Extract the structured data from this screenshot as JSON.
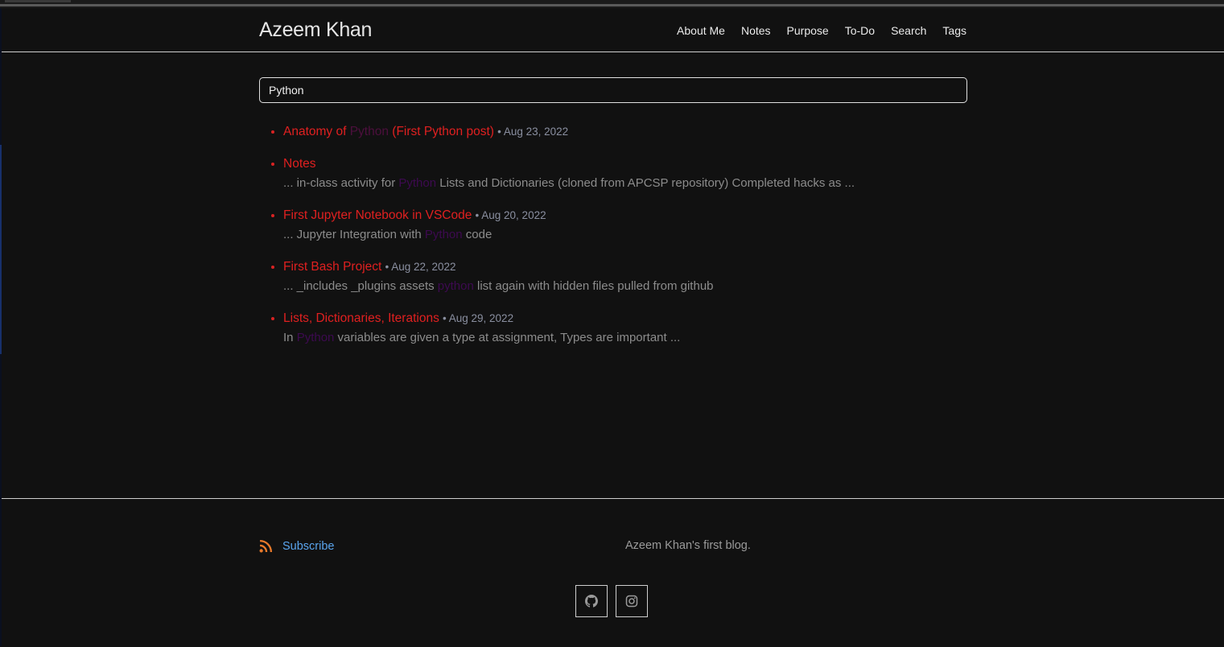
{
  "site": {
    "title": "Azeem Khan",
    "nav": [
      "About Me",
      "Notes",
      "Purpose",
      "To-Do",
      "Search",
      "Tags"
    ]
  },
  "search": {
    "value": "Python",
    "placeholder": ""
  },
  "results": [
    {
      "title_before": "Anatomy of ",
      "title_highlight": "Python",
      "title_after": " (First Python post)",
      "date": "Aug 23, 2022",
      "excerpt_before": "",
      "excerpt_highlight": "",
      "excerpt_after": ""
    },
    {
      "title_before": "Notes",
      "title_highlight": "",
      "title_after": "",
      "date": "",
      "excerpt_before": "... in-class activity for ",
      "excerpt_highlight": "Python",
      "excerpt_after": " Lists and Dictionaries (cloned from APCSP repository) Completed hacks as ..."
    },
    {
      "title_before": "First Jupyter Notebook in VSCode",
      "title_highlight": "",
      "title_after": "",
      "date": "Aug 20, 2022",
      "excerpt_before": "... Jupyter Integration with ",
      "excerpt_highlight": "Python",
      "excerpt_after": " code"
    },
    {
      "title_before": "First Bash Project",
      "title_highlight": "",
      "title_after": "",
      "date": "Aug 22, 2022",
      "excerpt_before": "... _includes _plugins assets ",
      "excerpt_highlight": "python",
      "excerpt_after": " list again with hidden files pulled from github"
    },
    {
      "title_before": "Lists, Dictionaries, Iterations",
      "title_highlight": "",
      "title_after": "",
      "date": "Aug 29, 2022",
      "excerpt_before": "In ",
      "excerpt_highlight": "Python",
      "excerpt_after": " variables are given a type at assignment, Types are important ..."
    }
  ],
  "date_separator": "•",
  "footer": {
    "subscribe_label": "Subscribe",
    "description": "Azeem Khan's first blog.",
    "social_icons": [
      "github-icon",
      "instagram-icon"
    ]
  },
  "colors": {
    "background": "#111111",
    "link_red": "#e02020",
    "highlight": "#4d0f3d",
    "subscribe_blue": "#5aa5ee",
    "rss_orange": "#e8792a"
  }
}
